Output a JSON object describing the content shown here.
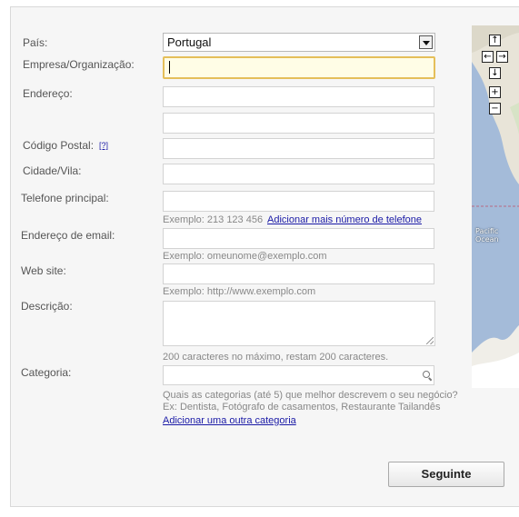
{
  "form": {
    "country": {
      "label": "País:",
      "value": "Portugal"
    },
    "company": {
      "label": "Empresa/Organização:",
      "value": ""
    },
    "address": {
      "label": "Endereço:"
    },
    "postal_code": {
      "label": "Código Postal:",
      "help": "[?]"
    },
    "city": {
      "label": "Cidade/Vila:"
    },
    "phone": {
      "label": "Telefone principal:",
      "hint": "Exemplo: 213 123 456",
      "add_link": "Adicionar mais número de telefone"
    },
    "email": {
      "label": "Endereço de email:",
      "hint": "Exemplo: omeunome@exemplo.com"
    },
    "website": {
      "label": "Web site:",
      "hint": "Exemplo: http://www.exemplo.com"
    },
    "description": {
      "label": "Descrição:",
      "hint": "200 caracteres no máximo, restam 200 caracteres."
    },
    "category": {
      "label": "Categoria:",
      "hint1": "Quais as categorias (até 5) que melhor descrevem o seu negócio?",
      "hint2": "Ex: Dentista, Fotógrafo de casamentos, Restaurante Tailandês",
      "add_link": "Adicionar uma outra categoria"
    },
    "next_button": "Seguinte"
  },
  "map": {
    "ocean_label_line1": "Pacific",
    "ocean_label_line2": "Ocean",
    "controls": {
      "pan_up": "↑",
      "pan_left": "←",
      "pan_right": "→",
      "pan_down": "↓",
      "zoom_in": "+",
      "zoom_out": "−"
    },
    "colors": {
      "water": "#a4bbd9",
      "land": "#e8e4d8",
      "boundary": "#c0506a"
    }
  }
}
